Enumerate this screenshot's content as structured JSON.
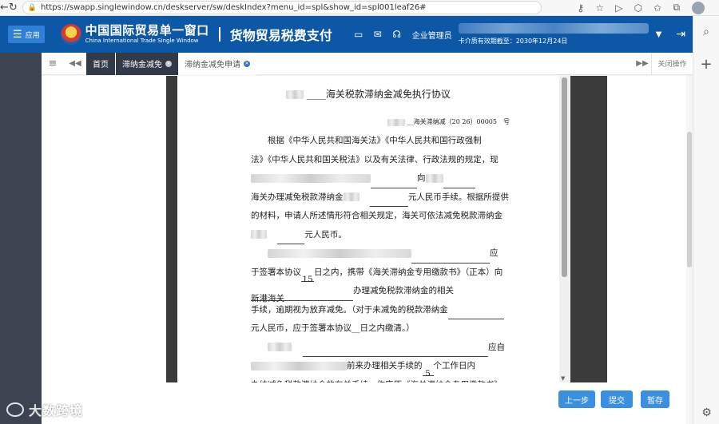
{
  "browser": {
    "url": "https://swapp.singlewindow.cn/deskserver/sw/deskIndex?menu_id=spl&show_id=spl001leaf26#"
  },
  "header": {
    "app_button_label": "应用",
    "brand_cn": "中国国际贸易单一窗口",
    "brand_en": "China International Trade Single Window",
    "system_title": "货物贸易税费支付",
    "user_role": "企业管理员",
    "card_expiry": "卡介质有效期截至：2030年12月24日"
  },
  "tabs": [
    {
      "label": "首页"
    },
    {
      "label": "滞纳金减免"
    },
    {
      "label": "滞纳金减免申请"
    }
  ],
  "tab_bar": {
    "close_ops": "关闭操作"
  },
  "doc": {
    "title": "____海关税款滞纳金减免执行协议",
    "doc_number": "__海关滞纳减（20 26）00005　号",
    "p1_line1": "根据《中华人民共和国海关法》《中华人民共和国行政强制",
    "p1_line2": "法》《中华人民共和国关税法》以及有关法律、行政法规的规定，现",
    "p1_line3_mid": "向",
    "p1_line4_a": "海关办理减免税款滞纳金",
    "p1_line4_b": "元人民币手续。根据所提供",
    "p1_line5": "的材料，申请人所述情形符合相关规定，海关可依法减免税款滞纳金",
    "p1_line6": "元人民币。",
    "p2_line1_end": "应",
    "p2_line2_a": "于签署本协议",
    "p2_line2_days": "15",
    "p2_line2_b": "日之内，携带《海关滞纳金专用缴款书》（正本）向",
    "p2_line3_customs": "新港海关",
    "p2_line3_b": "办理减免税款滞纳金的相关",
    "p2_line4": "手续，逾期视为放弃减免。（对于未减免的税款滞纳金",
    "p2_line5": "元人民币，应于签署本协议__日之内缴清。）",
    "p3_line1_end": "应自",
    "p3_line2_a": "前来办理相关手续的",
    "p3_line2_days": "5",
    "p3_line2_b": "个工作日内",
    "p3_line3": "办结减免税款滞纳金的有关手续，作废原《海关滞纳金专用缴款书》"
  },
  "buttons": {
    "prev": "上一步",
    "submit": "提交",
    "save": "暂存"
  },
  "watermark": "大数跨境"
}
